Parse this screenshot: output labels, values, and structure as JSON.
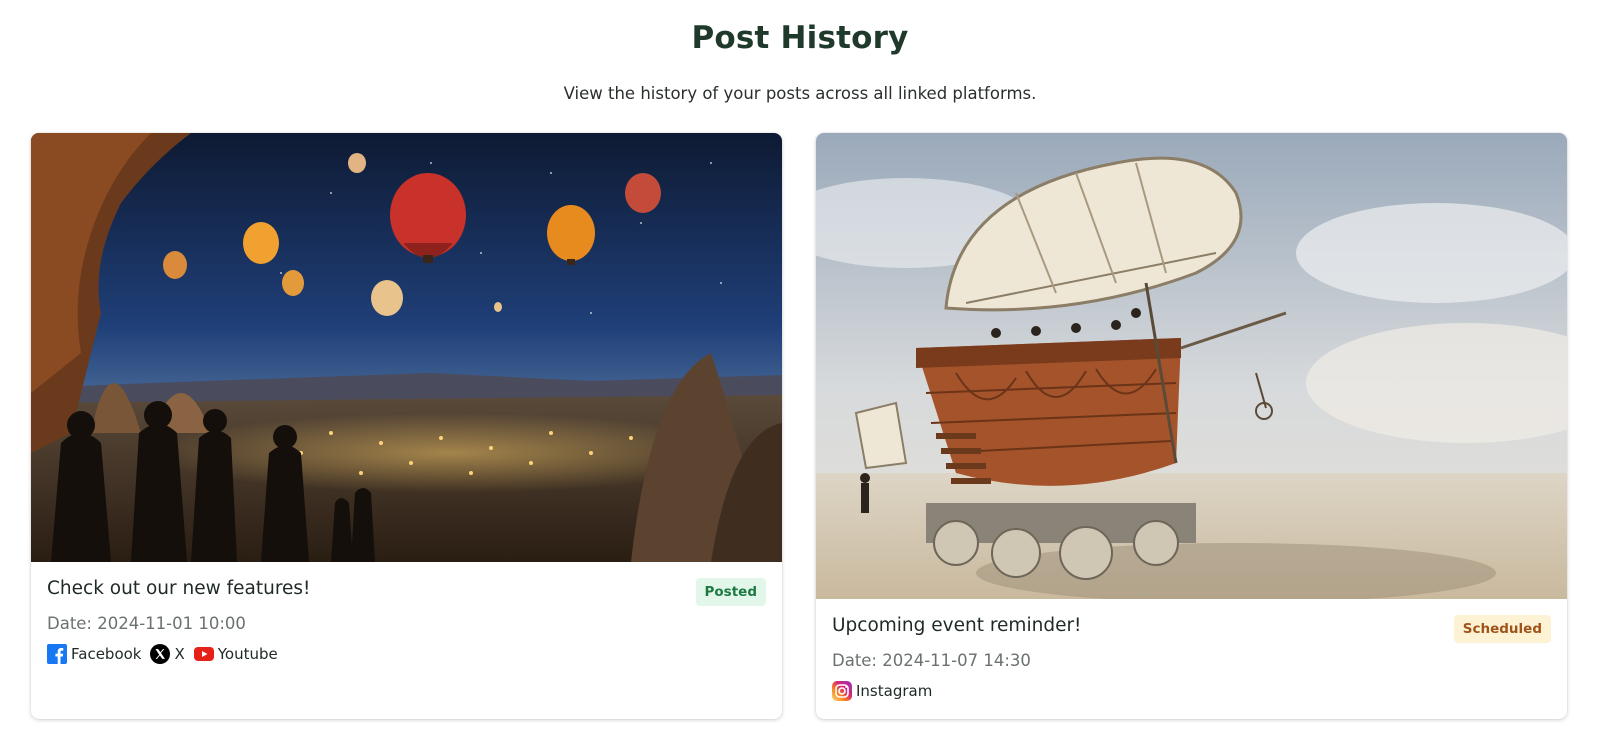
{
  "header": {
    "title": "Post History",
    "subtitle": "View the history of your posts across all linked platforms."
  },
  "posts": [
    {
      "title": "Check out our new features!",
      "status": "Posted",
      "date": "Date: 2024-11-01 10:00",
      "image_icon": "hot-air-balloons-night-photo",
      "platforms": [
        {
          "label": "Facebook",
          "icon": "facebook-icon",
          "color": "#1877f2"
        },
        {
          "label": "X",
          "icon": "x-icon",
          "color": "#000000"
        },
        {
          "label": "Youtube",
          "icon": "youtube-icon",
          "color": "#e62117"
        }
      ]
    },
    {
      "title": "Upcoming event reminder!",
      "status": "Scheduled",
      "date": "Date: 2024-11-07 14:30",
      "image_icon": "art-car-ship-desert-photo",
      "platforms": [
        {
          "label": "Instagram",
          "icon": "instagram-icon",
          "color": "#e4405f"
        }
      ]
    }
  ],
  "colors": {
    "posted_bg": "#e3f6ea",
    "posted_text": "#1d7a43",
    "scheduled_bg": "#fdf3d4",
    "scheduled_text": "#a0541a",
    "title": "#1f3a2b"
  }
}
